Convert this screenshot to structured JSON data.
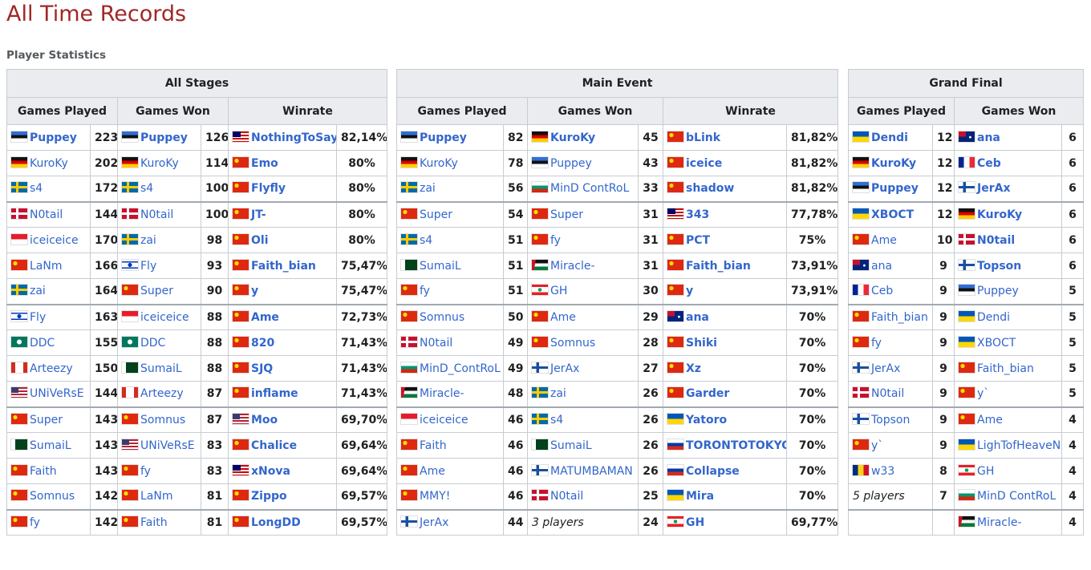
{
  "page": {
    "title": "All Time Records",
    "section": "Player Statistics"
  },
  "colors": {
    "title": "#a02727",
    "link": "#3366cc",
    "header_bg": "#eaecf0",
    "border": "#c8ccd1"
  },
  "tables": [
    {
      "group": "All Stages",
      "columns": [
        "Games Played",
        "Games Won",
        "Winrate"
      ],
      "rows": [
        [
          {
            "flag": "est",
            "name": "Puppey",
            "bold": true,
            "value": "223"
          },
          {
            "flag": "est",
            "name": "Puppey",
            "bold": true,
            "value": "126"
          },
          {
            "flag": "mys",
            "name": "NothingToSay",
            "bold": true,
            "value": "82,14%"
          }
        ],
        [
          {
            "flag": "ger",
            "name": "KuroKy",
            "bold": false,
            "value": "202"
          },
          {
            "flag": "ger",
            "name": "KuroKy",
            "bold": false,
            "value": "114"
          },
          {
            "flag": "chn",
            "name": "Emo",
            "bold": true,
            "value": "80%"
          }
        ],
        [
          {
            "flag": "swe",
            "name": "s4",
            "bold": false,
            "value": "172"
          },
          {
            "flag": "swe",
            "name": "s4",
            "bold": false,
            "value": "100"
          },
          {
            "flag": "chn",
            "name": "Flyfly",
            "bold": true,
            "value": "80%"
          }
        ],
        [
          {
            "flag": "den",
            "name": "N0tail",
            "bold": false,
            "value": "144"
          },
          {
            "flag": "den",
            "name": "N0tail",
            "bold": false,
            "value": "100"
          },
          {
            "flag": "chn",
            "name": "JT-",
            "bold": true,
            "value": "80%"
          }
        ],
        [
          {
            "flag": "sgp",
            "name": "iceiceice",
            "bold": false,
            "value": "170"
          },
          {
            "flag": "swe",
            "name": "zai",
            "bold": false,
            "value": "98"
          },
          {
            "flag": "chn",
            "name": "Oli",
            "bold": true,
            "value": "80%"
          }
        ],
        [
          {
            "flag": "chn",
            "name": "LaNm",
            "bold": false,
            "value": "166"
          },
          {
            "flag": "isr",
            "name": "Fly",
            "bold": false,
            "value": "93"
          },
          {
            "flag": "chn",
            "name": "Faith_bian",
            "bold": true,
            "value": "75,47%"
          }
        ],
        [
          {
            "flag": "swe",
            "name": "zai",
            "bold": false,
            "value": "164"
          },
          {
            "flag": "chn",
            "name": "Super",
            "bold": false,
            "value": "90"
          },
          {
            "flag": "chn",
            "name": "y",
            "bold": true,
            "value": "75,47%"
          }
        ],
        [
          {
            "flag": "isr",
            "name": "Fly",
            "bold": false,
            "value": "163"
          },
          {
            "flag": "sgp",
            "name": "iceiceice",
            "bold": false,
            "value": "88"
          },
          {
            "flag": "chn",
            "name": "Ame",
            "bold": true,
            "value": "72,73%"
          }
        ],
        [
          {
            "flag": "mac",
            "name": "DDC",
            "bold": false,
            "value": "155"
          },
          {
            "flag": "mac",
            "name": "DDC",
            "bold": false,
            "value": "88"
          },
          {
            "flag": "chn",
            "name": "820",
            "bold": true,
            "value": "71,43%"
          }
        ],
        [
          {
            "flag": "can",
            "name": "Arteezy",
            "bold": false,
            "value": "150"
          },
          {
            "flag": "pak",
            "name": "SumaiL",
            "bold": false,
            "value": "88"
          },
          {
            "flag": "chn",
            "name": "SJQ",
            "bold": true,
            "value": "71,43%"
          }
        ],
        [
          {
            "flag": "usa",
            "name": "UNiVeRsE",
            "bold": false,
            "value": "144"
          },
          {
            "flag": "can",
            "name": "Arteezy",
            "bold": false,
            "value": "87"
          },
          {
            "flag": "chn",
            "name": "inflame",
            "bold": true,
            "value": "71,43%"
          }
        ],
        [
          {
            "flag": "chn",
            "name": "Super",
            "bold": false,
            "value": "143"
          },
          {
            "flag": "chn",
            "name": "Somnus",
            "bold": false,
            "value": "87"
          },
          {
            "flag": "usa",
            "name": "Moo",
            "bold": true,
            "value": "69,70%"
          }
        ],
        [
          {
            "flag": "pak",
            "name": "SumaiL",
            "bold": false,
            "value": "143"
          },
          {
            "flag": "usa",
            "name": "UNiVeRsE",
            "bold": false,
            "value": "83"
          },
          {
            "flag": "chn",
            "name": "Chalice",
            "bold": true,
            "value": "69,64%"
          }
        ],
        [
          {
            "flag": "chn",
            "name": "Faith",
            "bold": false,
            "value": "143"
          },
          {
            "flag": "chn",
            "name": "fy",
            "bold": false,
            "value": "83"
          },
          {
            "flag": "mys",
            "name": "xNova",
            "bold": true,
            "value": "69,64%"
          }
        ],
        [
          {
            "flag": "chn",
            "name": "Somnus",
            "bold": false,
            "value": "142"
          },
          {
            "flag": "chn",
            "name": "LaNm",
            "bold": false,
            "value": "81"
          },
          {
            "flag": "chn",
            "name": "Zippo",
            "bold": true,
            "value": "69,57%"
          }
        ],
        [
          {
            "flag": "chn",
            "name": "fy",
            "bold": false,
            "value": "142"
          },
          {
            "flag": "chn",
            "name": "Faith",
            "bold": false,
            "value": "81"
          },
          {
            "flag": "chn",
            "name": "LongDD",
            "bold": true,
            "value": "69,57%"
          }
        ]
      ]
    },
    {
      "group": "Main Event",
      "columns": [
        "Games Played",
        "Games Won",
        "Winrate"
      ],
      "rows": [
        [
          {
            "flag": "est",
            "name": "Puppey",
            "bold": true,
            "value": "82"
          },
          {
            "flag": "ger",
            "name": "KuroKy",
            "bold": true,
            "value": "45"
          },
          {
            "flag": "chn",
            "name": "bLink",
            "bold": true,
            "value": "81,82%"
          }
        ],
        [
          {
            "flag": "ger",
            "name": "KuroKy",
            "bold": false,
            "value": "78"
          },
          {
            "flag": "est",
            "name": "Puppey",
            "bold": false,
            "value": "43"
          },
          {
            "flag": "chn",
            "name": "iceice",
            "bold": true,
            "value": "81,82%"
          }
        ],
        [
          {
            "flag": "swe",
            "name": "zai",
            "bold": false,
            "value": "56"
          },
          {
            "flag": "bul",
            "name": "MinD ContRoL",
            "bold": false,
            "value": "33"
          },
          {
            "flag": "chn",
            "name": "shadow",
            "bold": true,
            "value": "81,82%"
          }
        ],
        [
          {
            "flag": "chn",
            "name": "Super",
            "bold": false,
            "value": "54"
          },
          {
            "flag": "chn",
            "name": "Super",
            "bold": false,
            "value": "31"
          },
          {
            "flag": "mys",
            "name": "343",
            "bold": true,
            "value": "77,78%"
          }
        ],
        [
          {
            "flag": "swe",
            "name": "s4",
            "bold": false,
            "value": "51"
          },
          {
            "flag": "chn",
            "name": "fy",
            "bold": false,
            "value": "31"
          },
          {
            "flag": "chn",
            "name": "PCT",
            "bold": true,
            "value": "75%"
          }
        ],
        [
          {
            "flag": "pak",
            "name": "SumaiL",
            "bold": false,
            "value": "51"
          },
          {
            "flag": "jor",
            "name": "Miracle-",
            "bold": false,
            "value": "31"
          },
          {
            "flag": "chn",
            "name": "Faith_bian",
            "bold": true,
            "value": "73,91%"
          }
        ],
        [
          {
            "flag": "chn",
            "name": "fy",
            "bold": false,
            "value": "51"
          },
          {
            "flag": "lbn",
            "name": "GH",
            "bold": false,
            "value": "30"
          },
          {
            "flag": "chn",
            "name": "y",
            "bold": true,
            "value": "73,91%"
          }
        ],
        [
          {
            "flag": "chn",
            "name": "Somnus",
            "bold": false,
            "value": "50"
          },
          {
            "flag": "chn",
            "name": "Ame",
            "bold": false,
            "value": "29"
          },
          {
            "flag": "aus",
            "name": "ana",
            "bold": true,
            "value": "70%"
          }
        ],
        [
          {
            "flag": "den",
            "name": "N0tail",
            "bold": false,
            "value": "49"
          },
          {
            "flag": "chn",
            "name": "Somnus",
            "bold": false,
            "value": "28"
          },
          {
            "flag": "chn",
            "name": "Shiki",
            "bold": true,
            "value": "70%"
          }
        ],
        [
          {
            "flag": "bul",
            "name": "MinD_ContRoL",
            "bold": false,
            "value": "49"
          },
          {
            "flag": "fin",
            "name": "JerAx",
            "bold": false,
            "value": "27"
          },
          {
            "flag": "chn",
            "name": "Xz",
            "bold": true,
            "value": "70%"
          }
        ],
        [
          {
            "flag": "jor",
            "name": "Miracle-",
            "bold": false,
            "value": "48"
          },
          {
            "flag": "swe",
            "name": "zai",
            "bold": false,
            "value": "26"
          },
          {
            "flag": "chn",
            "name": "Garder",
            "bold": true,
            "value": "70%"
          }
        ],
        [
          {
            "flag": "sgp",
            "name": "iceiceice",
            "bold": false,
            "value": "46"
          },
          {
            "flag": "swe",
            "name": "s4",
            "bold": false,
            "value": "26"
          },
          {
            "flag": "ukr",
            "name": "Yatoro",
            "bold": true,
            "value": "70%"
          }
        ],
        [
          {
            "flag": "chn",
            "name": "Faith",
            "bold": false,
            "value": "46"
          },
          {
            "flag": "pak",
            "name": "SumaiL",
            "bold": false,
            "value": "26"
          },
          {
            "flag": "rus",
            "name": "TORONTOTOKYO",
            "bold": true,
            "value": "70%"
          }
        ],
        [
          {
            "flag": "chn",
            "name": "Ame",
            "bold": false,
            "value": "46"
          },
          {
            "flag": "fin",
            "name": "MATUMBAMAN",
            "bold": false,
            "value": "26"
          },
          {
            "flag": "rus",
            "name": "Collapse",
            "bold": true,
            "value": "70%"
          }
        ],
        [
          {
            "flag": "chn",
            "name": "MMY!",
            "bold": false,
            "value": "46"
          },
          {
            "flag": "den",
            "name": "N0tail",
            "bold": false,
            "value": "25"
          },
          {
            "flag": "ukr",
            "name": "Mira",
            "bold": true,
            "value": "70%"
          }
        ],
        [
          {
            "flag": "fin",
            "name": "JerAx",
            "bold": false,
            "value": "44"
          },
          {
            "flag": "",
            "name": "3 players",
            "italic": true,
            "value": "24"
          },
          {
            "flag": "lbn",
            "name": "GH",
            "bold": true,
            "value": "69,77%"
          }
        ]
      ]
    },
    {
      "group": "Grand Final",
      "columns": [
        "Games Played",
        "Games Won"
      ],
      "rows": [
        [
          {
            "flag": "ukr",
            "name": "Dendi",
            "bold": true,
            "value": "12"
          },
          {
            "flag": "aus",
            "name": "ana",
            "bold": true,
            "value": "6"
          }
        ],
        [
          {
            "flag": "ger",
            "name": "KuroKy",
            "bold": true,
            "value": "12"
          },
          {
            "flag": "fra",
            "name": "Ceb",
            "bold": true,
            "value": "6"
          }
        ],
        [
          {
            "flag": "est",
            "name": "Puppey",
            "bold": true,
            "value": "12"
          },
          {
            "flag": "fin",
            "name": "JerAx",
            "bold": true,
            "value": "6"
          }
        ],
        [
          {
            "flag": "ukr",
            "name": "XBOCT",
            "bold": true,
            "value": "12"
          },
          {
            "flag": "ger",
            "name": "KuroKy",
            "bold": true,
            "value": "6"
          }
        ],
        [
          {
            "flag": "chn",
            "name": "Ame",
            "bold": false,
            "value": "10"
          },
          {
            "flag": "den",
            "name": "N0tail",
            "bold": true,
            "value": "6"
          }
        ],
        [
          {
            "flag": "aus",
            "name": "ana",
            "bold": false,
            "value": "9"
          },
          {
            "flag": "fin",
            "name": "Topson",
            "bold": true,
            "value": "6"
          }
        ],
        [
          {
            "flag": "fra",
            "name": "Ceb",
            "bold": false,
            "value": "9"
          },
          {
            "flag": "est",
            "name": "Puppey",
            "bold": false,
            "value": "5"
          }
        ],
        [
          {
            "flag": "chn",
            "name": "Faith_bian",
            "bold": false,
            "value": "9"
          },
          {
            "flag": "ukr",
            "name": "Dendi",
            "bold": false,
            "value": "5"
          }
        ],
        [
          {
            "flag": "chn",
            "name": "fy",
            "bold": false,
            "value": "9"
          },
          {
            "flag": "ukr",
            "name": "XBOCT",
            "bold": false,
            "value": "5"
          }
        ],
        [
          {
            "flag": "fin",
            "name": "JerAx",
            "bold": false,
            "value": "9"
          },
          {
            "flag": "chn",
            "name": "Faith_bian",
            "bold": false,
            "value": "5"
          }
        ],
        [
          {
            "flag": "den",
            "name": "N0tail",
            "bold": false,
            "value": "9"
          },
          {
            "flag": "chn",
            "name": "y`",
            "bold": false,
            "value": "5"
          }
        ],
        [
          {
            "flag": "fin",
            "name": "Topson",
            "bold": false,
            "value": "9"
          },
          {
            "flag": "chn",
            "name": "Ame",
            "bold": false,
            "value": "4"
          }
        ],
        [
          {
            "flag": "chn",
            "name": "y`",
            "bold": false,
            "value": "9"
          },
          {
            "flag": "ukr",
            "name": "LighTofHeaveN",
            "bold": false,
            "value": "4"
          }
        ],
        [
          {
            "flag": "rom",
            "name": "w33",
            "bold": false,
            "value": "8"
          },
          {
            "flag": "lbn",
            "name": "GH",
            "bold": false,
            "value": "4"
          }
        ],
        [
          {
            "flag": "",
            "name": "5 players",
            "italic": true,
            "value": "7"
          },
          {
            "flag": "bul",
            "name": "MinD ContRoL",
            "bold": false,
            "value": "4"
          }
        ],
        [
          {
            "flag": "",
            "name": "",
            "value": ""
          },
          {
            "flag": "jor",
            "name": "Miracle-",
            "bold": false,
            "value": "4"
          }
        ]
      ]
    }
  ]
}
